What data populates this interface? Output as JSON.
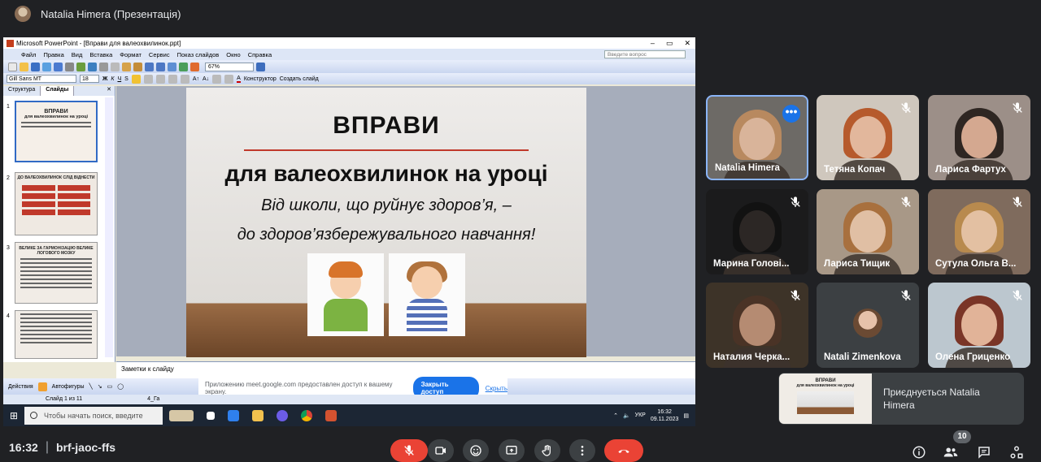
{
  "meeting": {
    "presenter_title": "Natalia Himera (Презентація)",
    "time": "16:32",
    "code": "brf-jaoc-ffs",
    "participant_count": "10",
    "join_notice": "Приєднується Natalia Himera"
  },
  "ppt": {
    "window_title": "Microsoft PowerPoint - [Вправи для валеохвилинок.ppt]",
    "menu": [
      "Файл",
      "Правка",
      "Вид",
      "Вставка",
      "Формат",
      "Сервис",
      "Показ слайдов",
      "Окно",
      "Справка"
    ],
    "help_placeholder": "Введите вопрос",
    "zoom": "67%",
    "font": "Gill Sans MT",
    "font_size": "18",
    "konstruktor": "Конструктор",
    "create_slide": "Создать слайд",
    "tabs": [
      "Структура",
      "Слайды"
    ],
    "thumbnails": [
      {
        "num": "1",
        "title": "ВПРАВИ",
        "sub": "для валеохвилинок на уроці"
      },
      {
        "num": "2",
        "title": "ДО ВАЛЕОХВИЛИНОК СЛІД ВІДНЕСТИ"
      },
      {
        "num": "3",
        "title": "ВЕЛИКЕ ЗА ГАРМОНІЗАЦІЮ ВЕЛИКЕ ЛОГОВОГО МОЗКУ"
      },
      {
        "num": "4",
        "title": ""
      }
    ],
    "slide": {
      "title": "ВПРАВИ",
      "subtitle": "для валеохвилинок на уроці",
      "line1": "Від школи, що руйнує здоров’я, –",
      "line2": "до здоров’язбережувального навчання!"
    },
    "notes_placeholder": "Заметки к слайду",
    "draw_actions": "Действия",
    "draw_autoshapes": "Автофигуры",
    "status_slide": "Слайд 1 из 11",
    "status_design": "4_Га",
    "share_notice": "Приложению meet.google.com предоставлен доступ к вашему экрану.",
    "stop_sharing": "Закрыть доступ",
    "hide": "Скрыть",
    "taskbar_search": "Чтобы начать поиск, введите",
    "tray_lang": "УКР",
    "tray_time": "16:32",
    "tray_date": "09.11.2023"
  },
  "participants": [
    {
      "name": "Natalia Himera",
      "muted": false,
      "active": true,
      "bg": "#6d6a66",
      "skin": "#d9b49a",
      "hair": "#b8895f"
    },
    {
      "name": "Тетяна Копач",
      "muted": true,
      "active": false,
      "bg": "#cfc7bd",
      "skin": "#e2b79c",
      "hair": "#b65a2c"
    },
    {
      "name": "Лариса Фартух",
      "muted": true,
      "active": false,
      "bg": "#9c8f88",
      "skin": "#d4a890",
      "hair": "#2e2622"
    },
    {
      "name": "Марина Голові...",
      "muted": true,
      "active": false,
      "bg": "#1b1b1c",
      "skin": "#2c2725",
      "hair": "#121212"
    },
    {
      "name": "Лариса Тищик",
      "muted": true,
      "active": false,
      "bg": "#a89887",
      "skin": "#e0bfa4",
      "hair": "#a8703e"
    },
    {
      "name": "Сутула Ольга В...",
      "muted": true,
      "active": false,
      "bg": "#7f6b5d",
      "skin": "#e3c0a2",
      "hair": "#b88a4e"
    },
    {
      "name": "Наталия Черка...",
      "muted": true,
      "active": false,
      "bg": "#3d3328",
      "skin": "#b58b72",
      "hair": "#4a3326"
    },
    {
      "name": "Natali Zimenkova",
      "muted": true,
      "active": false,
      "bg": "#3c4043",
      "skin": "#e6c2aa",
      "hair": "#6b4a33"
    },
    {
      "name": "Олена Гриценко",
      "muted": true,
      "active": false,
      "bg": "#bcc7cf",
      "skin": "#e1b398",
      "hair": "#7a3527"
    }
  ],
  "colors": {
    "meet_bg": "#202124",
    "tile_bg": "#3c4043",
    "accent": "#8ab4f8",
    "danger": "#ea4335"
  }
}
